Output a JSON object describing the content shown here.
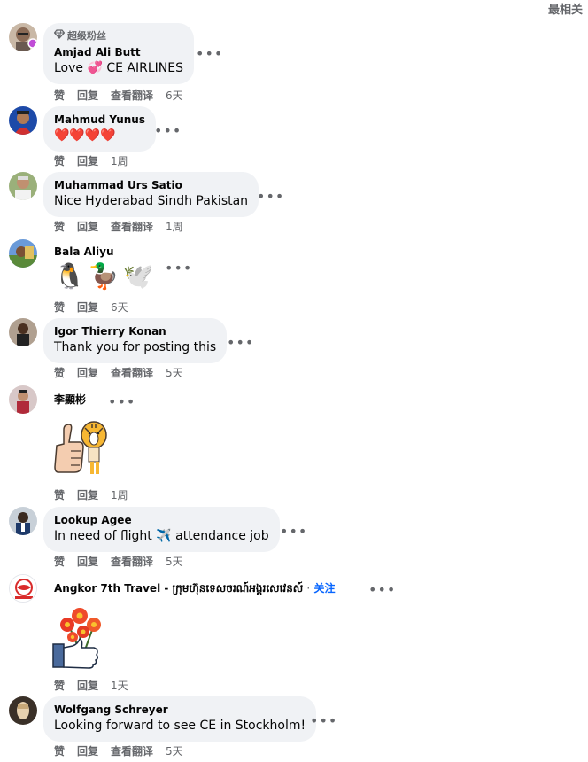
{
  "header": {
    "sort_label": "最相关"
  },
  "actions": {
    "like": "赞",
    "reply": "回复",
    "translate": "查看翻译"
  },
  "comments": [
    {
      "badge": "超级粉丝",
      "author": "Amjad Ali Butt",
      "text": "Love 💞 CE AIRLINES",
      "time": "6天",
      "has_translate": true
    },
    {
      "author": "Mahmud Yunus",
      "text": "❤️❤️❤️❤️",
      "time": "1周",
      "has_translate": false
    },
    {
      "author": "Muhammad Urs Satio",
      "text": "Nice Hyderabad Sindh Pakistan",
      "time": "1周",
      "has_translate": true
    },
    {
      "author": "Bala Aliyu",
      "emojis": [
        "🐧",
        "🦆",
        "🕊️"
      ],
      "time": "6天",
      "has_translate": false
    },
    {
      "author": "Igor Thierry Konan",
      "text": "Thank you for posting this",
      "time": "5天",
      "has_translate": true
    },
    {
      "author": "李顯彬",
      "sticker": "thumbs-up-tiger-sticker",
      "time": "1周",
      "has_translate": false
    },
    {
      "author": "Lookup Agee",
      "text": "In need of flight ✈️ attendance job",
      "time": "5天",
      "has_translate": true
    },
    {
      "author": "Angkor 7th Travel - ក្រុមហ៊ុនទេសចរណ៍អង្គរសេវេនស៍",
      "separator": "·",
      "follow": "关注",
      "sticker": "flower-like-sticker",
      "time": "1天",
      "has_translate": false
    },
    {
      "author": "Wolfgang Schreyer",
      "text": "Looking forward to see CE in Stockholm!",
      "time": "5天",
      "has_translate": true
    }
  ],
  "icons": {
    "more": "more-options-icon",
    "badge": "diamond-icon"
  },
  "colors": {
    "bubble": "#f0f2f5",
    "secondary_text": "#65676b",
    "link": "#0866ff"
  }
}
